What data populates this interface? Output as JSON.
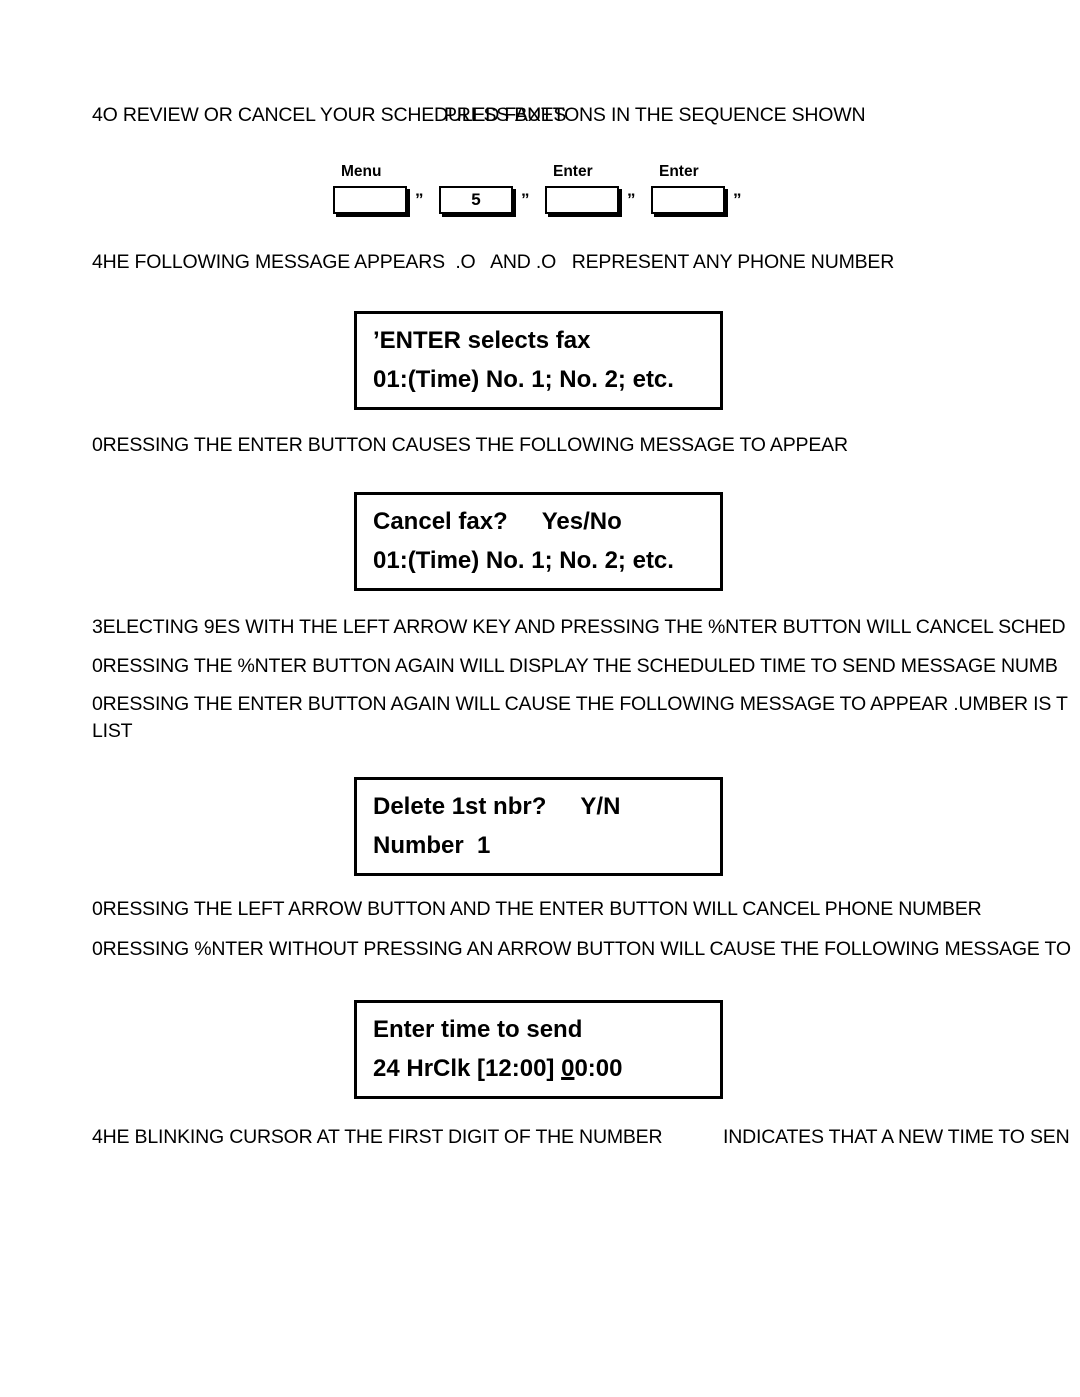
{
  "header": {
    "line_a": "4O REVIEW OR CANCEL YOUR SCHEDULED FAXES",
    "line_b": "PRESS BUTTONS IN THE SEQUENCE SHOWN"
  },
  "keypad": {
    "separator": "”",
    "buttons": [
      {
        "label": "Menu",
        "value": ""
      },
      {
        "label": "",
        "value": "5"
      },
      {
        "label": "Enter",
        "value": ""
      },
      {
        "label": "Enter",
        "value": ""
      }
    ]
  },
  "paragraphs": {
    "p1": "4HE FOLLOWING MESSAGE APPEARS  .O   AND .O   REPRESENT ANY PHONE NUMBER",
    "p2": "0RESSING THE ENTER BUTTON CAUSES THE FOLLOWING MESSAGE TO APPEAR",
    "p3": "3ELECTING 9ES WITH THE LEFT ARROW KEY AND PRESSING THE %NTER BUTTON WILL CANCEL SCHED",
    "p4": "0RESSING THE %NTER BUTTON AGAIN WILL DISPLAY THE SCHEDULED TIME TO SEND MESSAGE NUMB",
    "p5": "0RESSING THE ENTER BUTTON AGAIN WILL CAUSE THE FOLLOWING MESSAGE TO APPEAR  .UMBER  IS T LIST",
    "p6": "0RESSING THE LEFT ARROW BUTTON AND THE ENTER BUTTON WILL CANCEL PHONE NUMBER",
    "p7": "0RESSING %NTER WITHOUT PRESSING AN ARROW BUTTON WILL CAUSE THE FOLLOWING MESSAGE TO",
    "p8_a": "4HE BLINKING CURSOR AT THE FIRST DIGIT OF THE NUMBER",
    "p8_b": "INDICATES THAT A NEW TIME TO SEN"
  },
  "displays": {
    "d1": {
      "line1": "’ENTER selects fax",
      "line2": "01:(Time) No. 1; No. 2; etc."
    },
    "d2": {
      "line1_left": "Cancel fax?",
      "line1_right": "Yes/No",
      "line2": "01:(Time) No. 1; No. 2; etc."
    },
    "d3": {
      "line1_left": "Delete 1st nbr?",
      "line1_right": "Y/N",
      "line2": "Number  1"
    },
    "d4": {
      "line1": "Enter time to send",
      "line2_pre": "24 HrClk [12:00] ",
      "line2_cursor": "0",
      "line2_post": "0:00"
    }
  }
}
